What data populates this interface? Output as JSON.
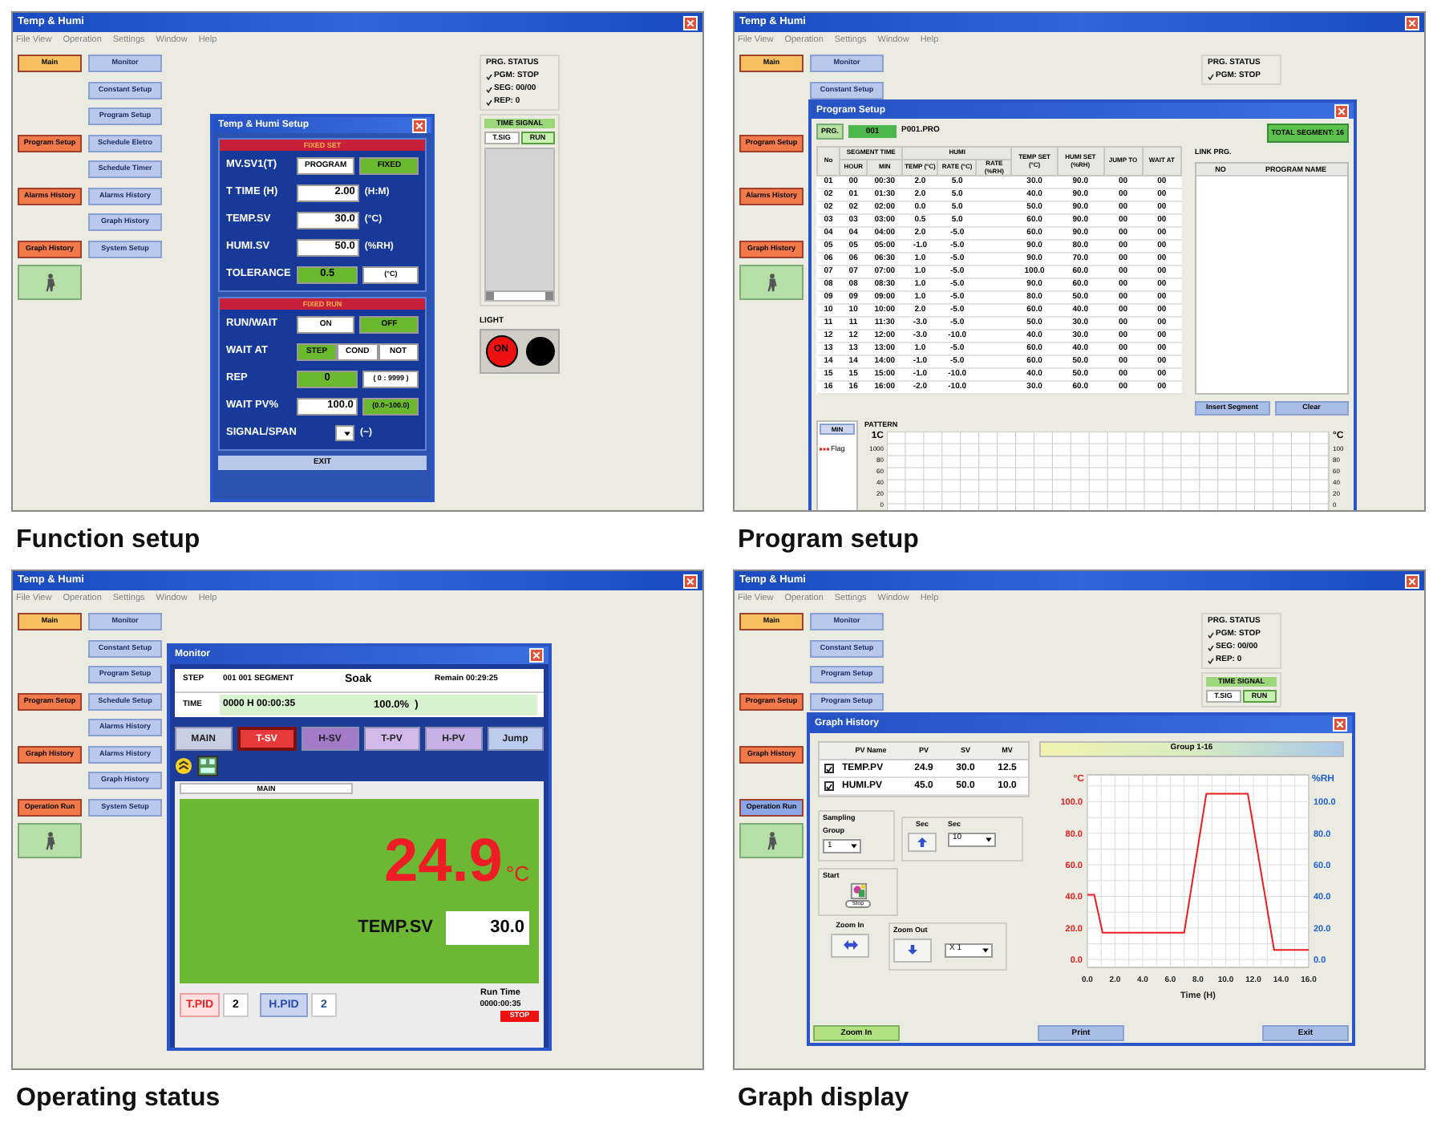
{
  "panels": [
    {
      "caption": "Function setup",
      "window": {
        "title": "Temp & Humi",
        "menu": [
          "File View",
          "Operation",
          "Settings",
          "Window",
          "Help"
        ]
      },
      "nav_left": [
        {
          "label": "Main",
          "color": "#f6c060"
        },
        {
          "label": "Program Setup",
          "color": "#f27a4a"
        },
        {
          "label": "Alarms History",
          "color": "#f27a4a"
        },
        {
          "label": "Graph History",
          "color": "#f27a4a"
        }
      ],
      "nav_right": [
        "Monitor",
        "Constant Setup",
        "Program Setup",
        "Schedule Eletro",
        "Schedule Timer",
        "Alarms History",
        "Graph History",
        "System Setup"
      ],
      "status": {
        "title": "PRG. STATUS",
        "items": [
          "PGM: STOP",
          "SEG: 00/00",
          "REP: 0"
        ]
      },
      "time_signal": {
        "title": "TIME SIGNAL",
        "tabs": [
          {
            "label": "T.SIG",
            "selected": false
          },
          {
            "label": "RUN",
            "selected": true
          }
        ],
        "list": true
      },
      "light": {
        "title": "LIGHT",
        "label": "ON",
        "on": true
      },
      "dialog": {
        "kind": "setup",
        "title": "Temp & Humi Setup",
        "sections": [
          {
            "title": "FIXED SET",
            "rows": [
              {
                "label": "MV.SV1(T)",
                "cells": [
                  {
                    "kind": "option",
                    "text": "PROGRAM",
                    "selected": false
                  },
                  {
                    "kind": "option",
                    "text": "FIXED",
                    "selected": true
                  }
                ]
              },
              {
                "label": "T TIME (H)",
                "cells": [
                  {
                    "kind": "value",
                    "text": "2.00",
                    "highlight": false
                  },
                  {
                    "kind": "unit",
                    "text": "(H:M)"
                  }
                ]
              },
              {
                "label": "TEMP.SV",
                "cells": [
                  {
                    "kind": "value",
                    "text": "30.0",
                    "highlight": false
                  },
                  {
                    "kind": "unit",
                    "text": "(°C)"
                  }
                ]
              },
              {
                "label": "HUMI.SV",
                "cells": [
                  {
                    "kind": "value",
                    "text": "50.0",
                    "highlight": false
                  },
                  {
                    "kind": "unit",
                    "text": "(%RH)"
                  }
                ]
              },
              {
                "label": "TOLERANCE",
                "cells": [
                  {
                    "kind": "value",
                    "text": "0.5",
                    "highlight": true
                  },
                  {
                    "kind": "note",
                    "text": "(°C)",
                    "highlight": false
                  }
                ]
              }
            ]
          },
          {
            "title": "FIXED RUN",
            "rows": [
              {
                "label": "RUN/WAIT",
                "cells": [
                  {
                    "kind": "option",
                    "text": "ON",
                    "selected": false
                  },
                  {
                    "kind": "option",
                    "text": "OFF",
                    "selected": true
                  }
                ]
              },
              {
                "label": "WAIT AT",
                "cells": [
                  {
                    "kind": "option",
                    "text": "STEP",
                    "selected": true
                  },
                  {
                    "kind": "option",
                    "text": "COND",
                    "selected": false
                  },
                  {
                    "kind": "option",
                    "text": "NOT",
                    "selected": false
                  }
                ]
              },
              {
                "label": "REP",
                "cells": [
                  {
                    "kind": "value",
                    "text": "0",
                    "highlight": true
                  },
                  {
                    "kind": "note",
                    "text": "( 0 : 9999 )",
                    "highlight": false
                  }
                ]
              },
              {
                "label": "WAIT PV%",
                "cells": [
                  {
                    "kind": "value",
                    "text": "100.0",
                    "highlight": false
                  },
                  {
                    "kind": "note",
                    "text": "(0.0~100.0)",
                    "highlight": true
                  }
                ]
              },
              {
                "label": "SIGNAL/SPAN",
                "cells": [
                  {
                    "kind": "dropdown"
                  },
                  {
                    "kind": "unit",
                    "text": "(~)"
                  }
                ]
              }
            ]
          }
        ],
        "exit": "EXIT"
      }
    },
    {
      "caption": "Program setup",
      "window": {
        "title": "Temp & Humi",
        "menu": [
          "File View",
          "Operation",
          "Settings",
          "Window",
          "Help"
        ]
      },
      "nav_left": [
        {
          "label": "Main",
          "color": "#f6c060"
        },
        {
          "label": "Program Setup",
          "color": "#f27a4a"
        },
        {
          "label": "Alarms History",
          "color": "#f27a4a"
        },
        {
          "label": "Graph History",
          "color": "#f27a4a"
        }
      ],
      "nav_right": [
        "Monitor",
        "Constant Setup"
      ],
      "status": {
        "title": "PRG. STATUS",
        "items": [
          "PGM: STOP"
        ]
      },
      "dialog": {
        "kind": "program",
        "title": "Program Setup",
        "prg_label": "PRG.",
        "prg_number": "001",
        "prg_file": "P001.PRO",
        "link_label": "LINK PRG.",
        "total": "TOTAL SEGMENT:  16",
        "table": {
          "header": {
            "no": "No",
            "segment_time": "SEGMENT TIME",
            "hour": "HOUR",
            "min": "MIN",
            "humi": "HUMI",
            "temp": "TEMP (°C)",
            "rate": "RATE (°C)",
            "rate_rh": "RATE (%RH)",
            "temp_set": "TEMP SET (°C)",
            "humi_set": "HUMI SET (%RH)",
            "jump": "JUMP TO",
            "wait": "WAIT AT"
          },
          "rows": [
            [
              "01",
              "00",
              "00:30",
              "2.0",
              "5.0",
              "30.0",
              "90.0",
              "00",
              "00"
            ],
            [
              "02",
              "01",
              "01:30",
              "2.0",
              "5.0",
              "40.0",
              "90.0",
              "00",
              "00"
            ],
            [
              "02",
              "02",
              "02:00",
              "0.0",
              "5.0",
              "50.0",
              "90.0",
              "00",
              "00"
            ],
            [
              "03",
              "03",
              "03:00",
              "0.5",
              "5.0",
              "60.0",
              "90.0",
              "00",
              "00"
            ],
            [
              "04",
              "04",
              "04:00",
              "2.0",
              "-5.0",
              "60.0",
              "90.0",
              "00",
              "00"
            ],
            [
              "05",
              "05",
              "05:00",
              "-1.0",
              "-5.0",
              "90.0",
              "80.0",
              "00",
              "00"
            ],
            [
              "06",
              "06",
              "06:30",
              "1.0",
              "-5.0",
              "90.0",
              "70.0",
              "00",
              "00"
            ],
            [
              "07",
              "07",
              "07:00",
              "1.0",
              "-5.0",
              "100.0",
              "60.0",
              "00",
              "00"
            ],
            [
              "08",
              "08",
              "08:30",
              "1.0",
              "-5.0",
              "90.0",
              "60.0",
              "00",
              "00"
            ],
            [
              "09",
              "09",
              "09:00",
              "1.0",
              "-5.0",
              "80.0",
              "50.0",
              "00",
              "00"
            ],
            [
              "10",
              "10",
              "10:00",
              "2.0",
              "-5.0",
              "60.0",
              "40.0",
              "00",
              "00"
            ],
            [
              "11",
              "11",
              "11:30",
              "-3.0",
              "-5.0",
              "50.0",
              "30.0",
              "00",
              "00"
            ],
            [
              "12",
              "12",
              "12:00",
              "-3.0",
              "-10.0",
              "40.0",
              "30.0",
              "00",
              "00"
            ],
            [
              "13",
              "13",
              "13:00",
              "1.0",
              "-5.0",
              "60.0",
              "40.0",
              "00",
              "00"
            ],
            [
              "14",
              "14",
              "14:00",
              "-1.0",
              "-5.0",
              "60.0",
              "50.0",
              "00",
              "00"
            ],
            [
              "15",
              "15",
              "15:00",
              "-1.0",
              "-10.0",
              "40.0",
              "50.0",
              "00",
              "00"
            ],
            [
              "16",
              "16",
              "16:00",
              "-2.0",
              "-10.0",
              "30.0",
              "60.0",
              "00",
              "00"
            ]
          ]
        },
        "link_table": {
          "columns": [
            "NO",
            "PROGRAM NAME"
          ]
        },
        "buttons": [
          "Insert Segment",
          "Clear"
        ],
        "pattern": {
          "title": "PATTERN",
          "toggle": "MIN",
          "legend": "Flag",
          "left_unit": "1C",
          "left_ticks": [
            "1000",
            "80",
            "60",
            "40",
            "20",
            "0"
          ],
          "right_unit": "°C",
          "right_ticks": [
            "100",
            "80",
            "60",
            "40",
            "20",
            "0"
          ]
        }
      }
    },
    {
      "caption": "Operating status",
      "window": {
        "title": "Temp & Humi",
        "menu": [
          "File View",
          "Operation",
          "Settings",
          "Window",
          "Help"
        ]
      },
      "nav_left": [
        {
          "label": "Main",
          "color": "#f6c060"
        },
        {
          "label": "Program Setup",
          "color": "#f27a4a"
        },
        {
          "label": "Graph History",
          "color": "#f27a4a"
        },
        {
          "label": "Operation Run",
          "color": "#f27a4a"
        }
      ],
      "nav_right": [
        "Monitor",
        "Constant Setup",
        "Program Setup",
        "Schedule Setup",
        "Alarms History",
        "Alarms History",
        "Graph History",
        "System Setup"
      ],
      "dialog": {
        "kind": "monitor",
        "title": "Monitor",
        "step_label": "STEP",
        "segment": "001 001 SEGMENT",
        "mode": "Soak",
        "remain": "Remain 00:29:25",
        "time_label": "TIME",
        "time": "0000 H 00:00:35",
        "progress": "100.0%  )",
        "level": 1.0,
        "tabs": [
          {
            "label": "MAIN",
            "color": "#c9cfe2",
            "selected": false
          },
          {
            "label": "T-SV",
            "color": "#e83a3a",
            "selected": true
          },
          {
            "label": "H-SV",
            "color": "#a27ac8",
            "selected": false
          },
          {
            "label": "T-PV",
            "color": "#d3b8ea",
            "selected": false
          },
          {
            "label": "H-PV",
            "color": "#c7b0e6",
            "selected": false
          },
          {
            "label": "Jump",
            "color": "#bccbee",
            "selected": false
          }
        ],
        "panel_label": "MAIN",
        "value": "24.9",
        "unit": "°C",
        "sv_label": "TEMP.SV",
        "sv": "30.0",
        "t_pid_label": "T.PID",
        "t_pid": "2",
        "h_pid_label": "H.PID",
        "h_pid": "2",
        "run_time_label": "Run Time",
        "run_time": "0000:00:35",
        "stop": "STOP"
      }
    },
    {
      "caption": "Graph display",
      "window": {
        "title": "Temp & Humi",
        "menu": [
          "File View",
          "Operation",
          "Settings",
          "Window",
          "Help"
        ]
      },
      "nav_left": [
        {
          "label": "Main",
          "color": "#f6c060"
        },
        {
          "label": "Program Setup",
          "color": "#f27a4a"
        },
        {
          "label": "Graph History",
          "color": "#f27a4a"
        },
        {
          "label": "Operation Run",
          "color": "#8aa6e6"
        }
      ],
      "nav_right": [
        "Monitor",
        "Constant Setup",
        "Program Setup",
        "Program Setup"
      ],
      "status": {
        "title": "PRG. STATUS",
        "items": [
          "PGM: STOP",
          "SEG: 00/00",
          "REP: 0"
        ]
      },
      "time_signal": {
        "title": "TIME SIGNAL",
        "tabs": [
          {
            "label": "T.SIG",
            "selected": false
          },
          {
            "label": "RUN",
            "selected": true
          }
        ],
        "list": false
      },
      "dialog": {
        "kind": "graph",
        "title": "Graph History",
        "table": {
          "columns": [
            "PV Name",
            "PV",
            "SV",
            "MV"
          ],
          "rows": [
            {
              "checked": true,
              "cells": [
                "TEMP.PV",
                "24.9",
                "30.0",
                "12.5"
              ]
            },
            {
              "checked": true,
              "cells": [
                "HUMI.PV",
                "45.0",
                "50.0",
                "10.0"
              ]
            }
          ]
        },
        "sampling": "Sampling",
        "group_label": "Group",
        "group": "1",
        "sec_label": "Sec",
        "sec_label_2": "Sec",
        "sec": "10",
        "start": "Start",
        "stop": "Stop",
        "zoom_in": "Zoom In",
        "zoom_out": "Zoom Out",
        "zoom": "X 1",
        "group_bar": "Group 1-16",
        "right_axis": {
          "label": "%RH",
          "ticks": [
            "100.0",
            "80.0",
            "60.0",
            "40.0",
            "20.0",
            "0.0"
          ]
        },
        "chart_data": {
          "type": "line",
          "grid": true,
          "xlabel": "Time (H)",
          "ylabel": "°C",
          "x": [
            0,
            0.5,
            1.1,
            7.0,
            8.6,
            11.6,
            13.5,
            16
          ],
          "series": [
            {
              "color": "#ee1c1c",
              "values": [
                41,
                41,
                17,
                17,
                105,
                105,
                6,
                6
              ]
            }
          ],
          "xlim": [
            0,
            16
          ],
          "ylim": [
            -5,
            117
          ],
          "xticks": [
            {
              "value": 0,
              "label": "0.0"
            },
            {
              "value": 2,
              "label": "2.0"
            },
            {
              "value": 4,
              "label": "4.0"
            },
            {
              "value": 6,
              "label": "6.0"
            },
            {
              "value": 8,
              "label": "8.0"
            },
            {
              "value": 10,
              "label": "10.0"
            },
            {
              "value": 12,
              "label": "12.0"
            },
            {
              "value": 14,
              "label": "14.0"
            },
            {
              "value": 16,
              "label": "16.0"
            }
          ],
          "yticks": [
            {
              "value": 0,
              "label": "0.0"
            },
            {
              "value": 20,
              "label": "20.0"
            },
            {
              "value": 40,
              "label": "40.0"
            },
            {
              "value": 60,
              "label": "60.0"
            },
            {
              "value": 80,
              "label": "80.0"
            },
            {
              "value": 100,
              "label": "100.0"
            }
          ]
        },
        "bottom_buttons": [
          "Zoom In",
          "Print",
          "Exit"
        ]
      }
    }
  ]
}
